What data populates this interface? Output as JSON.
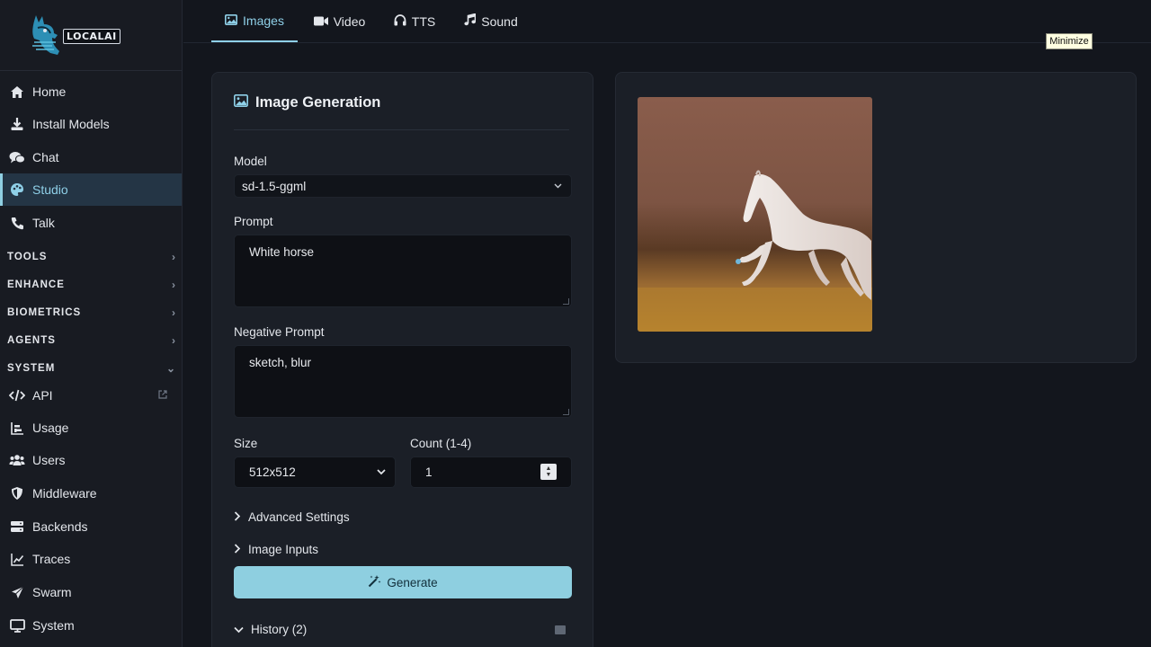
{
  "logo": {
    "text": "LOCALAI"
  },
  "sidebar": {
    "items": [
      {
        "label": "Home",
        "icon": "home-icon"
      },
      {
        "label": "Install Models",
        "icon": "download-icon"
      },
      {
        "label": "Chat",
        "icon": "chat-icon"
      },
      {
        "label": "Studio",
        "icon": "palette-icon",
        "active": true
      },
      {
        "label": "Talk",
        "icon": "phone-icon"
      }
    ],
    "sections": [
      {
        "label": "TOOLS",
        "expanded": false
      },
      {
        "label": "ENHANCE",
        "expanded": false
      },
      {
        "label": "BIOMETRICS",
        "expanded": false
      },
      {
        "label": "AGENTS",
        "expanded": false
      },
      {
        "label": "SYSTEM",
        "expanded": true
      }
    ],
    "system_items": [
      {
        "label": "API",
        "icon": "code-icon",
        "external": true
      },
      {
        "label": "Usage",
        "icon": "bar-chart-icon"
      },
      {
        "label": "Users",
        "icon": "users-icon"
      },
      {
        "label": "Middleware",
        "icon": "shield-icon"
      },
      {
        "label": "Backends",
        "icon": "server-icon"
      },
      {
        "label": "Traces",
        "icon": "line-chart-icon"
      },
      {
        "label": "Swarm",
        "icon": "send-icon"
      },
      {
        "label": "System",
        "icon": "monitor-icon"
      }
    ]
  },
  "tabs": [
    {
      "label": "Images",
      "icon": "image-icon",
      "active": true
    },
    {
      "label": "Video",
      "icon": "video-icon"
    },
    {
      "label": "TTS",
      "icon": "headphones-icon"
    },
    {
      "label": "Sound",
      "icon": "music-icon"
    }
  ],
  "tooltip": {
    "text": "Minimize"
  },
  "form": {
    "title": "Image Generation",
    "model_label": "Model",
    "model_value": "sd-1.5-ggml",
    "prompt_label": "Prompt",
    "prompt_value": "White horse",
    "negative_label": "Negative Prompt",
    "negative_value": "sketch, blur",
    "size_label": "Size",
    "size_value": "512x512",
    "count_label": "Count (1-4)",
    "count_value": "1",
    "advanced_label": "Advanced Settings",
    "image_inputs_label": "Image Inputs",
    "generate_label": "Generate",
    "history_label": "History (2)"
  },
  "colors": {
    "accent": "#8fd0e8",
    "background": "#13161d",
    "card": "#1b1f27",
    "button": "#8ecfe0"
  }
}
